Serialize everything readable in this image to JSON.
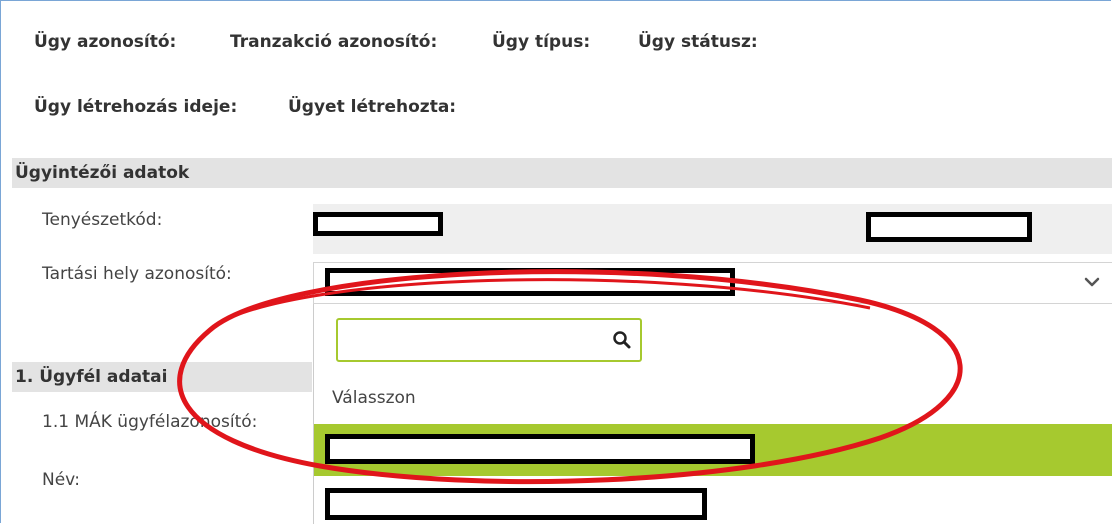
{
  "header": {
    "case_id_label": "Ügy azonosító:",
    "transaction_id_label": "Tranzakció azonosító:",
    "case_type_label": "Ügy típus:",
    "case_status_label": "Ügy státusz:",
    "created_at_label": "Ügy létrehozás ideje:",
    "created_by_label": "Ügyet létrehozta:"
  },
  "administrator_section": {
    "title": "Ügyintézői adatok",
    "farm_code_label": "Tenyészetkód:",
    "holding_place_label": "Tartási hely azonosító:"
  },
  "client_section": {
    "title": "1. Ügyfél adatai",
    "mak_id_label": "1.1 MÁK ügyfélazonosító:",
    "name_label": "Név:"
  },
  "dropdown": {
    "search_placeholder": "",
    "placeholder_option": "Válasszon"
  },
  "colors": {
    "accent_green": "#a6c92f",
    "annotation_red": "#e0151b"
  }
}
